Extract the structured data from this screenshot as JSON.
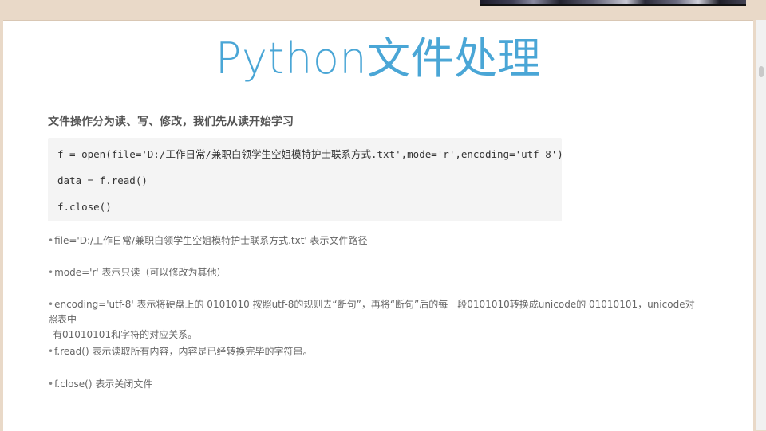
{
  "title": "Python文件处理",
  "intro": "文件操作分为读、写、修改，我们先从读开始学习",
  "code": {
    "line1": "f = open(file='D:/工作日常/兼职白领学生空姐模特护士联系方式.txt',mode='r',encoding='utf-8')",
    "line2": "data = f.read()",
    "line3": "f.close()"
  },
  "notes": {
    "bullet": "•",
    "file": "file='D:/工作日常/兼职白领学生空姐模特护士联系方式.txt' 表示文件路径",
    "mode": "mode='r' 表示只读（可以修改为其他）",
    "encoding_line1": "encoding='utf-8' 表示将硬盘上的 0101010 按照utf-8的规则去“断句”，再将“断句”后的每一段0101010转换成unicode的 01010101，unicode对照表中",
    "encoding_line2": "有01010101和字符的对应关系。",
    "read": "f.read() 表示读取所有内容，内容是已经转换完毕的字符串。",
    "close": "f.close() 表示关闭文件"
  }
}
